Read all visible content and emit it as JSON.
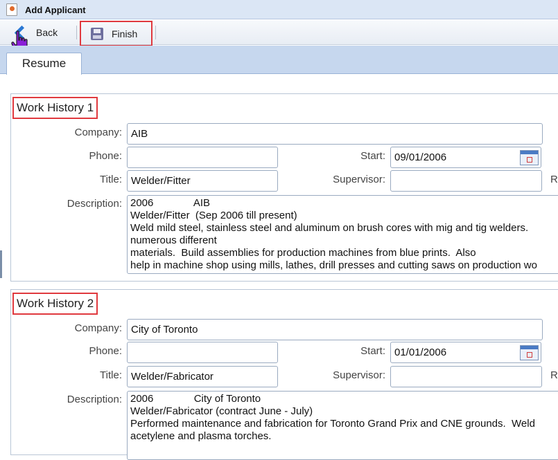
{
  "window": {
    "title": "Add Applicant"
  },
  "toolbar": {
    "back_label": "Back",
    "finish_label": "Finish"
  },
  "tabs": [
    {
      "label": "Resume"
    }
  ],
  "labels": {
    "company": "Company:",
    "phone": "Phone:",
    "title": "Title:",
    "description": "Description:",
    "start": "Start:",
    "supervisor": "Supervisor:",
    "cut_label": "R"
  },
  "work_history": [
    {
      "heading": "Work History 1",
      "company": "AIB",
      "phone": "",
      "title": "Welder/Fitter",
      "start": "09/01/2006",
      "supervisor": "",
      "description": "2006              AIB\nWelder/Fitter  (Sep 2006 till present)\nWeld mild steel, stainless steel and aluminum on brush cores with mig and tig welders.\nnumerous different\nmaterials.  Build assemblies for production machines from blue prints.  Also\nhelp in machine shop using mills, lathes, drill presses and cutting saws on production wo"
    },
    {
      "heading": "Work History 2",
      "company": "City of Toronto",
      "phone": "",
      "title": "Welder/Fabricator",
      "start": "01/01/2006",
      "supervisor": "",
      "description": "2006              City of Toronto\nWelder/Fabricator (contract June - July)\nPerformed maintenance and fabrication for Toronto Grand Prix and CNE grounds.  Weld\nacetylene and plasma torches."
    }
  ],
  "icons": {
    "app": "document-icon",
    "back": "back-arrow-icon",
    "finish": "save-disk-icon",
    "calendar": "calendar-icon",
    "cursor": "hand-pointer-cursor"
  },
  "colors": {
    "highlight": "#e0393e",
    "titlebar": "#dbe6f5",
    "tabbar": "#c6d7ee"
  }
}
